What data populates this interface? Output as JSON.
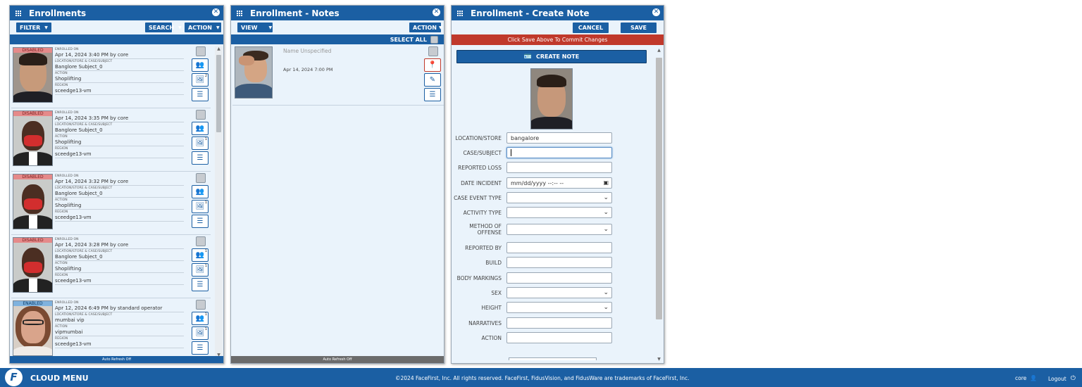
{
  "enrollments": {
    "title": "Enrollments",
    "filter_label": "FILTER",
    "search_label": "SEARCH",
    "action_label": "ACTION",
    "footer": "Auto Refresh Off",
    "field_labels": {
      "enrolled_on": "ENROLLED ON",
      "location": "LOCATION/STORE & CASE/SUBJECT",
      "action": "ACTION",
      "region": "REGION"
    },
    "cards": [
      {
        "status": "DISABLED",
        "enrolled": "Apr 14, 2024 3:40 PM by core",
        "location": "Banglore Subject_0",
        "action": "Shoplifting",
        "region": "sceedge13-vm",
        "badge1": "",
        "badge2": "2"
      },
      {
        "status": "DISABLED",
        "enrolled": "Apr 14, 2024 3:35 PM by core",
        "location": "Banglore Subject_0",
        "action": "Shoplifting",
        "region": "sceedge13-vm",
        "badge1": "",
        "badge2": "1"
      },
      {
        "status": "DISABLED",
        "enrolled": "Apr 14, 2024 3:32 PM by core",
        "location": "Banglore Subject_0",
        "action": "Shoplifting",
        "region": "sceedge13-vm",
        "badge1": "",
        "badge2": "1"
      },
      {
        "status": "DISABLED",
        "enrolled": "Apr 14, 2024 3:28 PM by core",
        "location": "Banglore Subject_0",
        "action": "Shoplifting",
        "region": "sceedge13-vm",
        "badge1": "1",
        "badge2": "1"
      },
      {
        "status": "ENABLED",
        "enrolled": "Apr 12, 2024 6:49 PM by standard operator",
        "location": "mumbai vip",
        "action": "vipmumbai",
        "region": "sceedge13-vm",
        "badge1": "1",
        "badge2": "1"
      }
    ]
  },
  "notes": {
    "title": "Enrollment - Notes",
    "view_label": "VIEW",
    "action_label": "ACTION",
    "select_all_label": "SELECT ALL",
    "footer": "Auto Refresh Off",
    "items": [
      {
        "name": "Name Unspecified",
        "date": "Apr 14, 2024 7:00 PM"
      }
    ]
  },
  "create_note": {
    "title": "Enrollment - Create Note",
    "cancel_label": "CANCEL",
    "save_label": "SAVE",
    "warning": "Click Save Above To Commit Changes",
    "create_label": "CREATE NOTE",
    "fields": {
      "location": {
        "label": "LOCATION/STORE",
        "value": "bangalore"
      },
      "case_subject": {
        "label": "CASE/SUBJECT",
        "value": ""
      },
      "reported_loss": {
        "label": "REPORTED LOSS",
        "value": ""
      },
      "date_incident": {
        "label": "DATE INCIDENT",
        "value": "mm/dd/yyyy --:-- --"
      },
      "case_event_type": {
        "label": "CASE EVENT TYPE",
        "value": ""
      },
      "activity_type": {
        "label": "ACTIVITY TYPE",
        "value": ""
      },
      "method_of_offense": {
        "label": "METHOD OF OFFENSE",
        "value": ""
      },
      "reported_by": {
        "label": "REPORTED BY",
        "value": ""
      },
      "build": {
        "label": "BUILD",
        "value": ""
      },
      "body_markings": {
        "label": "BODY MARKINGS",
        "value": ""
      },
      "sex": {
        "label": "SEX",
        "value": ""
      },
      "height": {
        "label": "HEIGHT",
        "value": ""
      },
      "narratives": {
        "label": "NARRATIVES",
        "value": ""
      },
      "action": {
        "label": "ACTION",
        "value": ""
      }
    }
  },
  "cloud_bar": {
    "menu_label": "CLOUD MENU",
    "copyright": "©2024 FaceFirst, Inc. All rights reserved. FaceFirst, FidusVision, and FidusWare are trademarks of FaceFirst, Inc.",
    "user": "core",
    "logout": "Logout"
  },
  "colors": {
    "primary": "#1b5fa3",
    "panel_bg": "#eaf3fb",
    "warning": "#c0392b",
    "disabled_badge": "#e58a8a",
    "enabled_badge": "#7fb2de"
  },
  "icons": [
    "grid-icon",
    "close-icon",
    "group-icon",
    "image-icon",
    "menu-icon",
    "map-pin-icon",
    "edit-icon",
    "id-card-icon",
    "user-icon",
    "power-icon",
    "facefirst-logo-icon"
  ]
}
